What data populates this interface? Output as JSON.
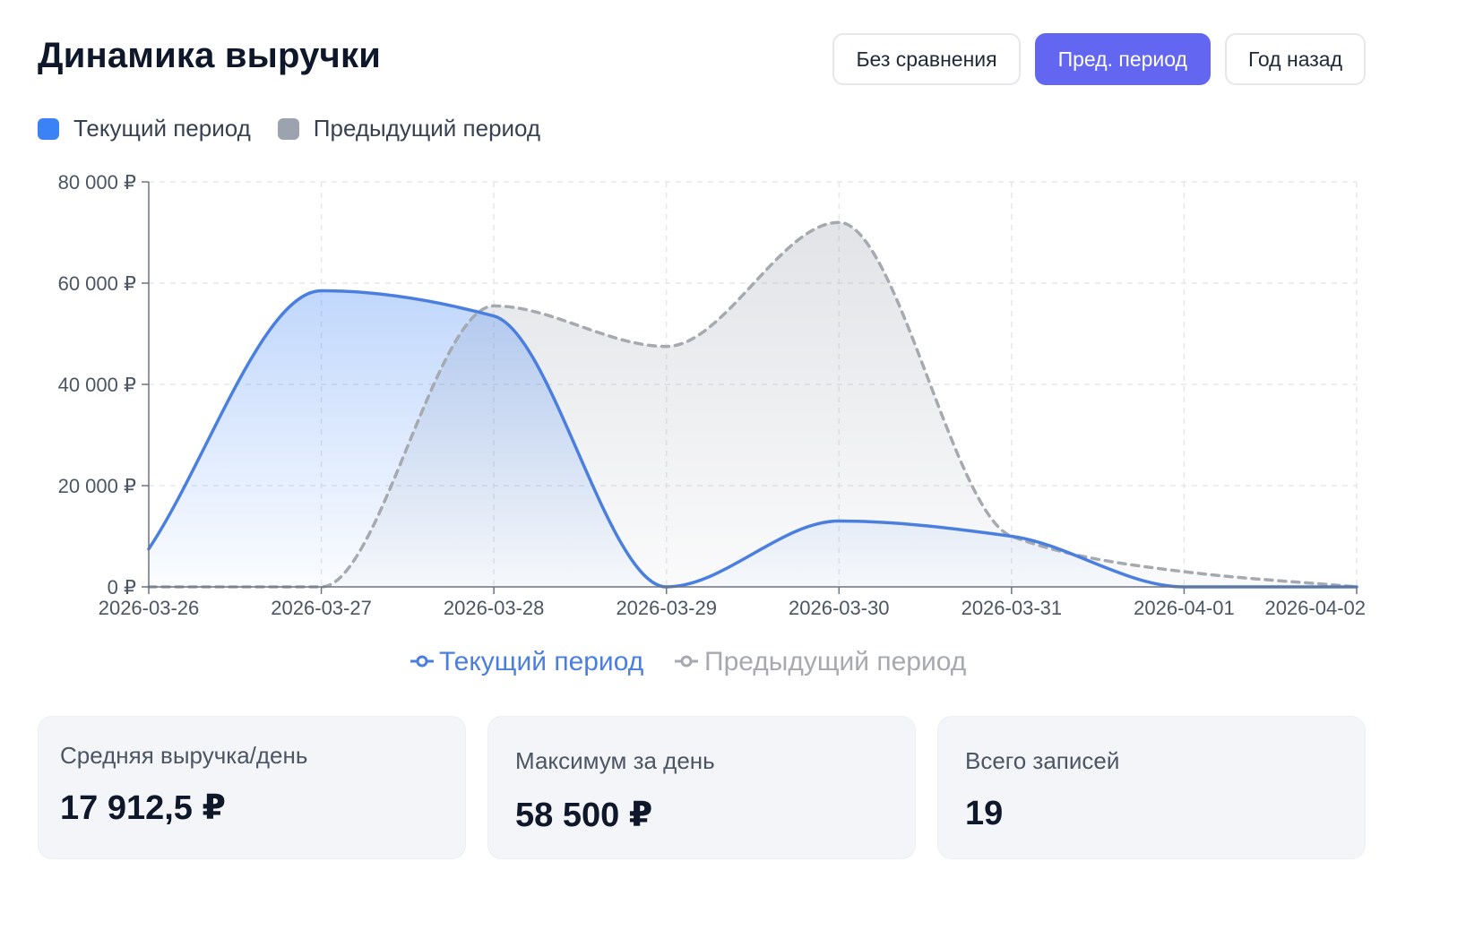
{
  "header": {
    "title": "Динамика выручки",
    "buttons": [
      {
        "label": "Без сравнения",
        "active": false
      },
      {
        "label": "Пред. период",
        "active": true
      },
      {
        "label": "Год назад",
        "active": false
      }
    ]
  },
  "legend": {
    "current": {
      "label": "Текущий период",
      "color": "#3b82f6"
    },
    "previous": {
      "label": "Предыдущий период",
      "color": "#9ca3af"
    }
  },
  "chart_data": {
    "type": "area",
    "x": [
      "2026-03-26",
      "2026-03-27",
      "2026-03-28",
      "2026-03-29",
      "2026-03-30",
      "2026-03-31",
      "2026-04-01",
      "2026-04-02"
    ],
    "yticks": [
      {
        "value": 0,
        "label": "0 ₽"
      },
      {
        "value": 20000,
        "label": "20 000 ₽"
      },
      {
        "value": 40000,
        "label": "40 000 ₽"
      },
      {
        "value": 60000,
        "label": "60 000 ₽"
      },
      {
        "value": 80000,
        "label": "80 000 ₽"
      }
    ],
    "ylim": [
      0,
      80000
    ],
    "grid": true,
    "legend_position": "bottom",
    "series": [
      {
        "name": "Текущий период",
        "color": "#3b82f6",
        "line_color": "#4a7fdf",
        "dashed": false,
        "values": [
          7500,
          58500,
          53500,
          0,
          13000,
          10000,
          0,
          0
        ]
      },
      {
        "name": "Предыдущий период",
        "color": "#9ca3af",
        "line_color": "#a6a9af",
        "dashed": true,
        "values": [
          0,
          0,
          55500,
          47500,
          72000,
          10000,
          3000,
          0
        ]
      }
    ]
  },
  "stats": [
    {
      "label": "Средняя выручка/день",
      "value": "17 912,5 ₽"
    },
    {
      "label": "Максимум за день",
      "value": "58 500 ₽"
    },
    {
      "label": "Всего записей",
      "value": "19"
    }
  ]
}
